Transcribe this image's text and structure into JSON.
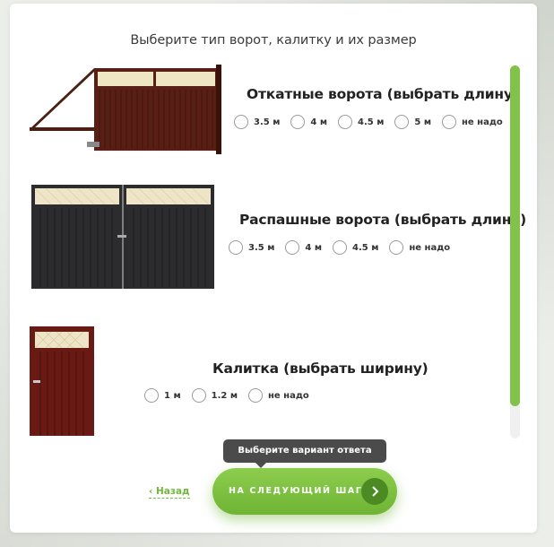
{
  "question": "Выберите тип ворот, калитку и их размер",
  "options": [
    {
      "title": "Откатные ворота (выбрать длину)",
      "sizes": [
        "3.5 м",
        "4 м",
        "4.5 м",
        "5 м",
        "не надо"
      ]
    },
    {
      "title": "Распашные ворота (выбрать длину)",
      "sizes": [
        "3.5 м",
        "4 м",
        "4.5 м",
        "не надо"
      ]
    },
    {
      "title": "Калитка (выбрать ширину)",
      "sizes": [
        "1 м",
        "1.2 м",
        "не надо"
      ]
    }
  ],
  "tooltip": "Выберите вариант ответа",
  "back_label": "Назад",
  "next_label": "НА СЛЕДУЮЩИЙ ШАГ",
  "colors": {
    "accent": "#82c24a",
    "button_dark": "#4c8a24",
    "tooltip_bg": "#4b4b4b"
  }
}
